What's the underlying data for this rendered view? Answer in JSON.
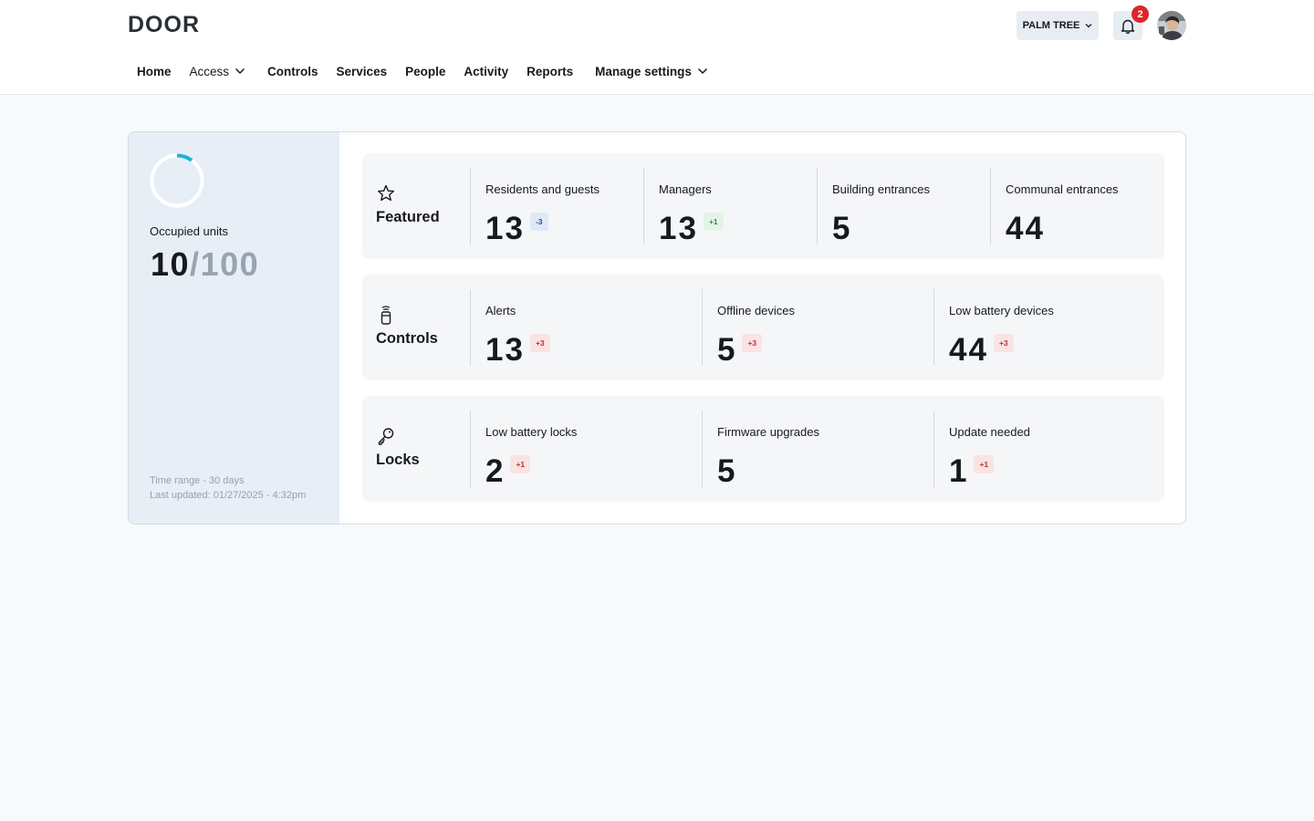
{
  "app": {
    "logo": "DOOR"
  },
  "header": {
    "property_label": "PALM TREE",
    "notification_count": "2"
  },
  "nav": {
    "items": [
      {
        "label": "Home",
        "has_dropdown": false
      },
      {
        "label": "Access",
        "has_dropdown": true
      },
      {
        "label": "Controls",
        "has_dropdown": false
      },
      {
        "label": "Services",
        "has_dropdown": false
      },
      {
        "label": "People",
        "has_dropdown": false
      },
      {
        "label": "Activity",
        "has_dropdown": false
      },
      {
        "label": "Reports",
        "has_dropdown": false
      },
      {
        "label": "Manage settings",
        "has_dropdown": true
      }
    ]
  },
  "summary": {
    "label": "Occupied units",
    "occupied": "10",
    "separator": "/",
    "total": "100",
    "occupancy_fraction": 0.1,
    "ring_color": "#1ab3d3",
    "time_range": "Time range - 30 days",
    "last_updated": "Last updated: 01/27/2025 - 4:32pm"
  },
  "cards": [
    {
      "title": "Featured",
      "icon": "star-icon",
      "stats": [
        {
          "label": "Residents and guests",
          "value": "13",
          "delta": "-3",
          "delta_tone": "blue"
        },
        {
          "label": "Managers",
          "value": "13",
          "delta": "+1",
          "delta_tone": "green"
        },
        {
          "label": "Building entrances",
          "value": "5",
          "delta": "",
          "delta_tone": ""
        },
        {
          "label": "Communal entrances",
          "value": "44",
          "delta": "",
          "delta_tone": ""
        }
      ]
    },
    {
      "title": "Controls",
      "icon": "remote-control-icon",
      "stats": [
        {
          "label": "Alerts",
          "value": "13",
          "delta": "+3",
          "delta_tone": "red"
        },
        {
          "label": "Offline devices",
          "value": "5",
          "delta": "+3",
          "delta_tone": "red"
        },
        {
          "label": "Low battery devices",
          "value": "44",
          "delta": "+3",
          "delta_tone": "red"
        }
      ]
    },
    {
      "title": "Locks",
      "icon": "key-icon",
      "stats": [
        {
          "label": "Low battery locks",
          "value": "2",
          "delta": "+1",
          "delta_tone": "red"
        },
        {
          "label": "Firmware upgrades",
          "value": "5",
          "delta": "",
          "delta_tone": ""
        },
        {
          "label": "Update needed",
          "value": "1",
          "delta": "+1",
          "delta_tone": "red"
        }
      ]
    }
  ]
}
